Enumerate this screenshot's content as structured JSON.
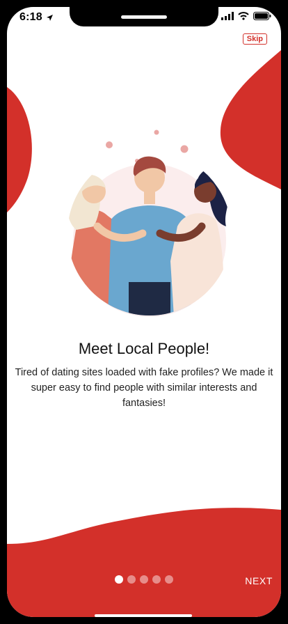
{
  "status_bar": {
    "time": "6:18",
    "icons": [
      "location-arrow-icon",
      "signal-icon",
      "wifi-icon",
      "battery-icon"
    ]
  },
  "skip_label": "Skip",
  "onboarding": {
    "title": "Meet Local People!",
    "description": "Tired of dating sites loaded with fake profiles? We made it super easy to find people with similar interests and fantasies!"
  },
  "pagination": {
    "total": 5,
    "current": 1
  },
  "next_label": "NEXT",
  "colors": {
    "accent": "#d3302a",
    "background": "#ffffff"
  }
}
